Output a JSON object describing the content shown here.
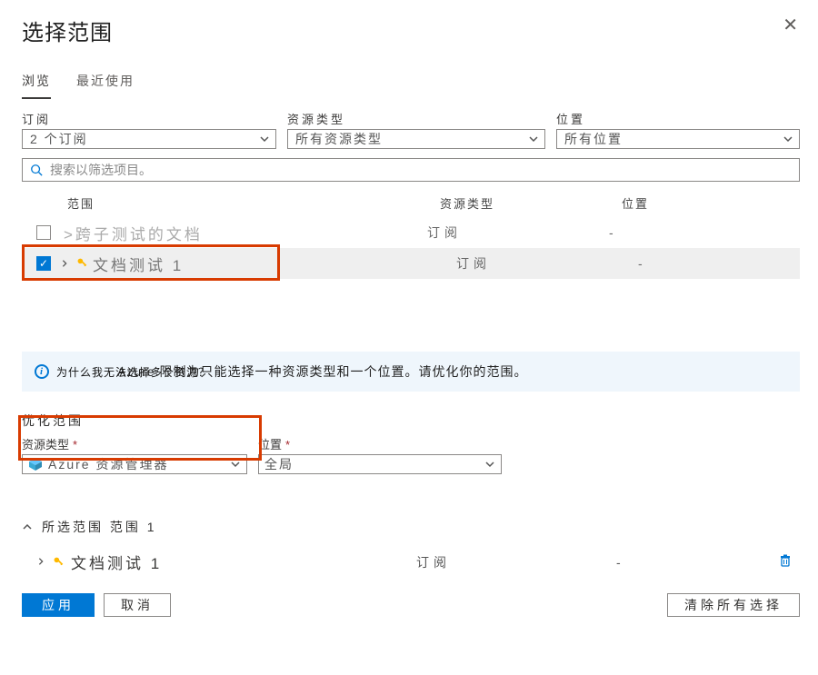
{
  "title": "选择范围",
  "tabs": {
    "browse": "浏览",
    "recent": "最近使用"
  },
  "filters": {
    "subscription": {
      "label": "订阅",
      "value": "2 个订阅"
    },
    "resourceType": {
      "label": "资源类型",
      "value": "所有资源类型"
    },
    "location": {
      "label": "位置",
      "value": "所有位置"
    }
  },
  "search": {
    "placeholder": "搜索以筛选项目。"
  },
  "columns": {
    "scope": "范围",
    "resourceType": "资源类型",
    "location": "位置"
  },
  "rows": [
    {
      "checked": false,
      "name": ">跨子测试的文档",
      "resourceType": "订阅",
      "location": "-",
      "keyIcon": false
    },
    {
      "checked": true,
      "name": "文档测试 1",
      "resourceType": "订阅",
      "location": "-",
      "keyIcon": true
    }
  ],
  "info": {
    "question": "为什么我无法选择多个资源？",
    "message": "Azure 限制为只能选择一种资源类型和一个位置。请优化你的范围。"
  },
  "refine": {
    "title": "优化范围",
    "resourceType": {
      "label": "资源类型",
      "value": "Azure 资源管理器"
    },
    "location": {
      "label": "位置",
      "value": "全局"
    }
  },
  "selected": {
    "header": "所选范围 范围 1",
    "row": {
      "name": "文档测试 1",
      "resourceType": "订阅",
      "location": "-"
    }
  },
  "footer": {
    "apply": "应用",
    "cancel": "取消",
    "clear": "清除所有选择"
  },
  "icons": {
    "search": "search-icon",
    "key": "key-icon",
    "cube": "cube-icon",
    "trash": "trash-icon",
    "info": "info-icon",
    "close": "close-icon",
    "chevronDown": "chevron-down-icon",
    "chevronRight": "chevron-right-icon",
    "chevronUp": "chevron-up-icon"
  },
  "colors": {
    "primary": "#0078d4",
    "highlight": "#d83b01",
    "infoBg": "#eff6fc"
  }
}
